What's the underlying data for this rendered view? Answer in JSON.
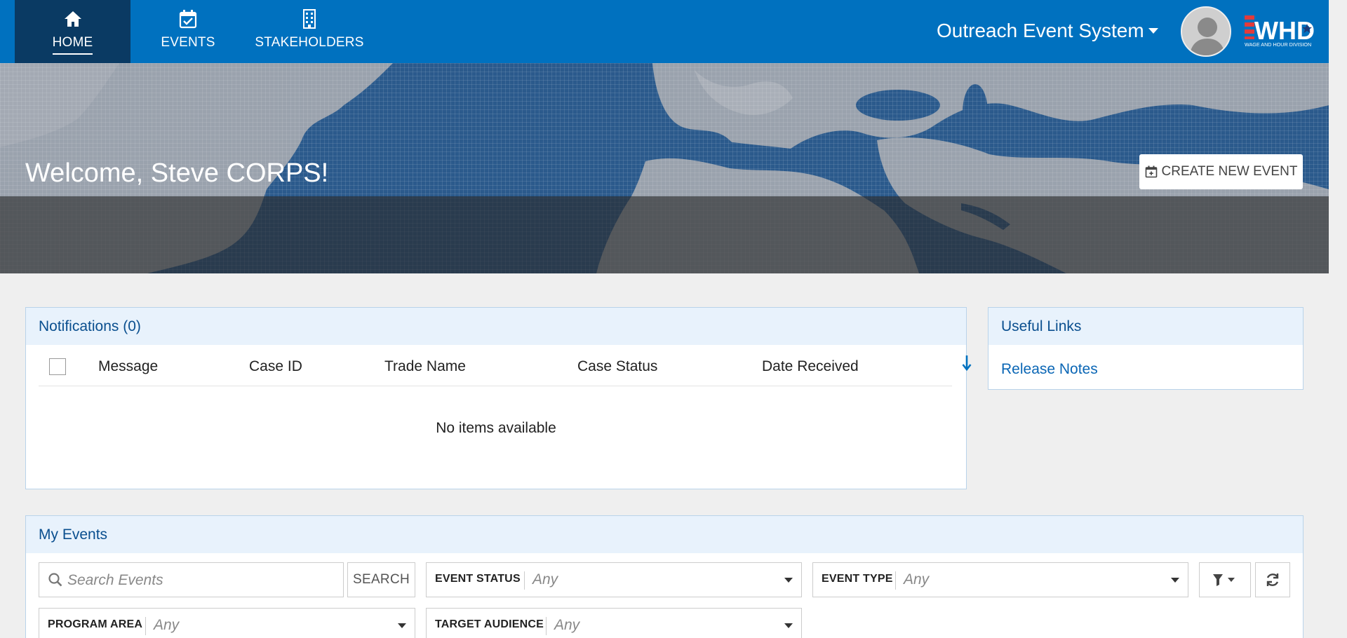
{
  "nav": {
    "items": [
      {
        "label": "HOME",
        "icon": "home-icon",
        "active": true
      },
      {
        "label": "EVENTS",
        "icon": "calendar-check-icon"
      },
      {
        "label": "STAKEHOLDERS",
        "icon": "building-icon"
      }
    ],
    "app_title": "Outreach Event System",
    "logo_text": "WHD",
    "logo_subtext": "WAGE AND HOUR DIVISION"
  },
  "hero": {
    "welcome": "Welcome, Steve CORPS!",
    "create_button": "CREATE NEW EVENT"
  },
  "notifications": {
    "title": "Notifications (0)",
    "columns": [
      "Message",
      "Case ID",
      "Trade Name",
      "Case Status",
      "Date Received"
    ],
    "empty_text": "No items available"
  },
  "useful_links": {
    "title": "Useful Links",
    "items": [
      "Release Notes"
    ]
  },
  "my_events": {
    "title": "My Events",
    "search_placeholder": "Search Events",
    "search_button": "SEARCH",
    "filters": {
      "event_status": {
        "label": "EVENT STATUS",
        "value": "Any"
      },
      "event_type": {
        "label": "EVENT TYPE",
        "value": "Any"
      },
      "program_area": {
        "label": "PROGRAM AREA",
        "value": "Any"
      },
      "target_audience": {
        "label": "TARGET AUDIENCE",
        "value": "Any"
      }
    }
  },
  "colors": {
    "nav_blue": "#0071bf",
    "nav_active": "#0a3a63",
    "panel_head": "#e8f2fc",
    "link": "#0a66b5"
  }
}
